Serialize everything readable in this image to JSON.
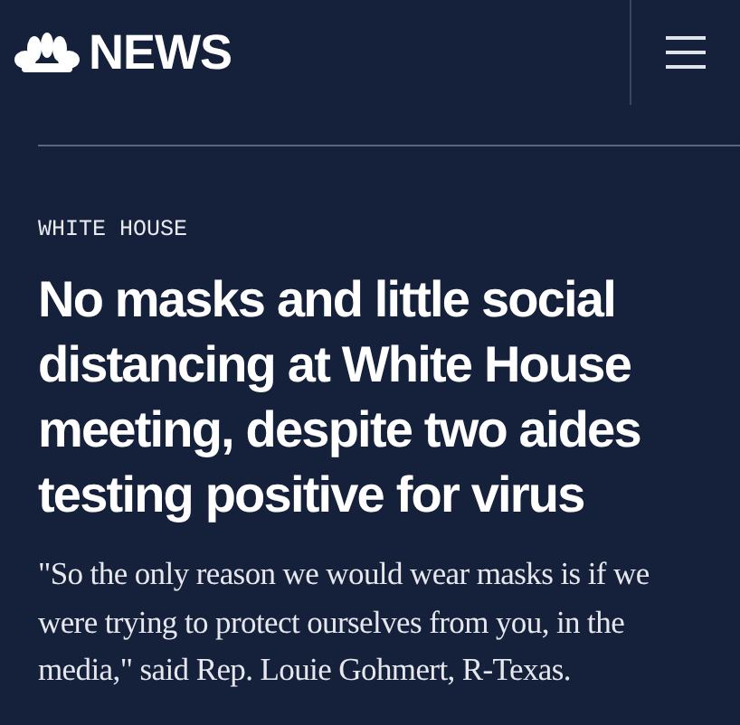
{
  "header": {
    "brand": "NEWS"
  },
  "article": {
    "section": "WHITE HOUSE",
    "headline": "No masks and little social distancing at White House meeting, despite two aides testing positive for virus",
    "dek": "\"So the only reason we would wear masks is if we were trying to protect ourselves from you, in the media,\" said Rep. Louie Gohmert, R-Texas."
  }
}
